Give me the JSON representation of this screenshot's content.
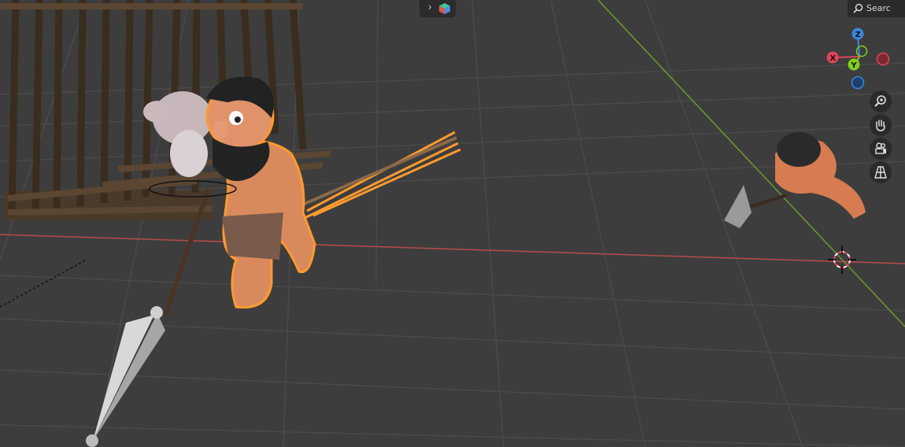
{
  "header": {
    "search_label": "Searc",
    "expand_icon": "chevron-right-icon",
    "editor_icon": "cube-icon"
  },
  "gizmo": {
    "z_label": "Z",
    "x_label": "X",
    "y_label": "Y",
    "x_color": "#e2445c",
    "y_color": "#7fcf1c",
    "z_color": "#3a86e0"
  },
  "nav_tools": [
    {
      "name": "zoom-icon"
    },
    {
      "name": "hand-pan-icon"
    },
    {
      "name": "camera-icon"
    },
    {
      "name": "grid-ortho-icon"
    }
  ],
  "scene": {
    "selection_color": "#ff9a2e",
    "x_axis_color": "#b74b4b",
    "y_axis_color": "#6b9b2d",
    "grid_color": "#4a4a4a"
  }
}
